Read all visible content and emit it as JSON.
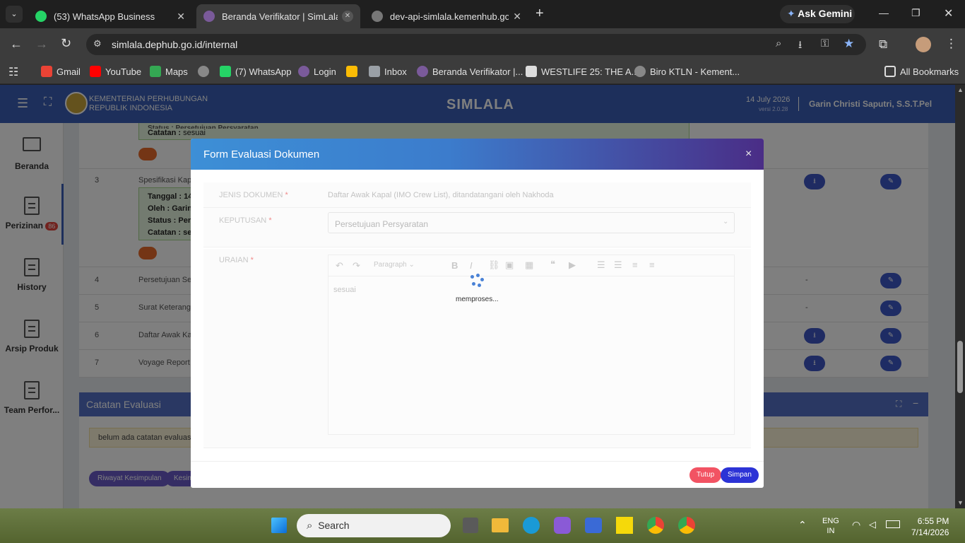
{
  "browser": {
    "tabs": [
      {
        "title": "(53) WhatsApp Business",
        "active": false
      },
      {
        "title": "Beranda Verifikator | SimLala",
        "active": true
      },
      {
        "title": "dev-api-simlala.kemenhub.go.id",
        "active": false
      }
    ],
    "ask_gemini": "Ask Gemini",
    "url": "simlala.dephub.go.id/internal",
    "bookmarks": [
      "Gmail",
      "YouTube",
      "Maps",
      "(7) WhatsApp",
      "Login",
      "Inbox",
      "Beranda Verifikator |...",
      "WESTLIFE 25: THE A...",
      "Biro KTLN - Kement..."
    ],
    "all_bookmarks": "All Bookmarks"
  },
  "app": {
    "org_line1": "KEMENTERIAN PERHUBUNGAN",
    "org_line2": "REPUBLIK INDONESIA",
    "title": "SIMLALA",
    "date": "14 July 2026",
    "version": "versi 2.0.28",
    "user": "Garin Christi Saputri, S.S.T.Pel"
  },
  "sidebar": [
    {
      "label": "Beranda"
    },
    {
      "label": "Perizinan",
      "badge": "86"
    },
    {
      "label": "History"
    },
    {
      "label": "Arsip Produk"
    },
    {
      "label": "Team Perfor..."
    }
  ],
  "table": {
    "row2_status": "Status : Persetujuan Persyaratan",
    "row2_catatan_label": "Catatan :",
    "row2_catatan": "sesuai",
    "row3_no": "3",
    "row3_doc": "Spesifikasi Kapal",
    "row3_tanggal": "Tanggal : 14",
    "row3_oleh": "Oleh : Garin C",
    "row3_status": "Status : Persetujuan",
    "row3_catatan": "Catatan : sesuai",
    "rows": [
      {
        "no": "4",
        "doc": "Persetujuan Seb",
        "dash": "-"
      },
      {
        "no": "5",
        "doc": "Surat Keterangan",
        "dash": "-"
      },
      {
        "no": "6",
        "doc": "Daftar Awak Kap",
        "dash": ""
      },
      {
        "no": "7",
        "doc": "Voyage Report (",
        "dash": ""
      }
    ]
  },
  "catatan_evaluasi": {
    "title": "Catatan Evaluasi",
    "note": "belum ada catatan evaluasi",
    "btn1": "Riwayat Kesimpulan",
    "btn2": "Kesim"
  },
  "modal": {
    "title": "Form Evaluasi Dokumen",
    "close": "×",
    "jenis_label": "JENIS DOKUMEN",
    "jenis_value": "Daftar Awak Kapal (IMO Crew List), ditandatangani oleh Nakhoda",
    "keputusan_label": "KEPUTUSAN",
    "keputusan_value": "Persetujuan Persyaratan",
    "uraian_label": "URAIAN",
    "editor_format": "Paragraph",
    "editor_content": "sesuai",
    "loading_text": "memproses...",
    "required_mark": "*",
    "btn_tutup": "Tutup",
    "btn_simpan": "Simpan"
  },
  "taskbar": {
    "search": "Search",
    "lang1": "ENG",
    "lang2": "IN",
    "time": "6:55 PM",
    "date": "7/14/2026"
  }
}
